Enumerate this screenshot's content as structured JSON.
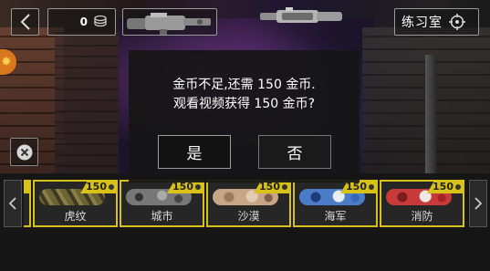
{
  "top_bar": {
    "coin_count": "0",
    "practice_label": "练习室"
  },
  "dialog": {
    "line1": "金币不足,还需 150 金币.",
    "line2": "观看视频获得 150 金币?",
    "yes_label": "是",
    "no_label": "否"
  },
  "skins": [
    {
      "name": "虎纹",
      "price": "150",
      "pattern_color": "#7a6a3a"
    },
    {
      "name": "城市",
      "price": "150",
      "pattern_color": "#8a8a8a"
    },
    {
      "name": "沙漠",
      "price": "150",
      "pattern_color": "#c9a88a"
    },
    {
      "name": "海军",
      "price": "150",
      "pattern_color": "#3f6fc0"
    },
    {
      "name": "消防",
      "price": "150",
      "pattern_color": "#c03434"
    }
  ],
  "colors": {
    "accent_yellow": "#d8c21a",
    "panel_dark": "#161616"
  },
  "icons": [
    "chevron-left-icon",
    "coins-icon",
    "crosshair-icon",
    "close-icon",
    "chevron-right-icon"
  ]
}
